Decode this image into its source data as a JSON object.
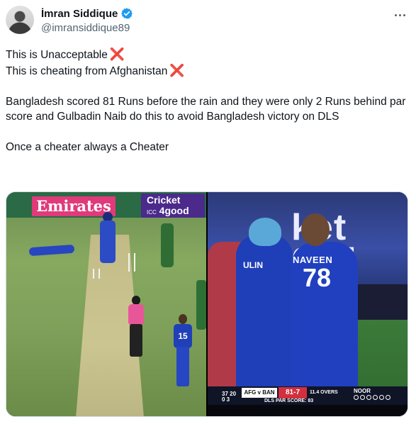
{
  "author": {
    "name": "İmran Siddique",
    "handle": "@imransiddique89",
    "verified_color": "#1d9bf0"
  },
  "tweet": {
    "lines": [
      "This is Unacceptable",
      "This is cheating from Afghanistan",
      "Bangladesh scored 81 Runs before the rain and they were only 2 Runs behind par score and Gulbadin Naib do this to avoid Bangladesh victory on DLS",
      "Once a cheater always a Cheater"
    ],
    "cross_mark": "❌"
  },
  "media": {
    "left": {
      "sponsor_board": "Emirates",
      "cricket4good_line1": "Cricket",
      "cricket4good_line2": "ICC",
      "cricket4good_line3": "4good",
      "fielder_number": "15"
    },
    "right": {
      "background_text": "ket\n00d",
      "player_names": [
        "ULIN",
        "NAVEEN"
      ],
      "player_number": "78",
      "scorebar": {
        "stat_left_top": "37 20",
        "stat_left_bottom": "0 3",
        "teams": "AFG v BAN",
        "score": "81-7",
        "overs": "11.4 OVERS",
        "par": "DLS PAR SCORE: 83",
        "bowler": "NOOR"
      }
    }
  },
  "icons": [
    "verified-badge-icon",
    "more-options-icon",
    "cross-mark-icon"
  ]
}
